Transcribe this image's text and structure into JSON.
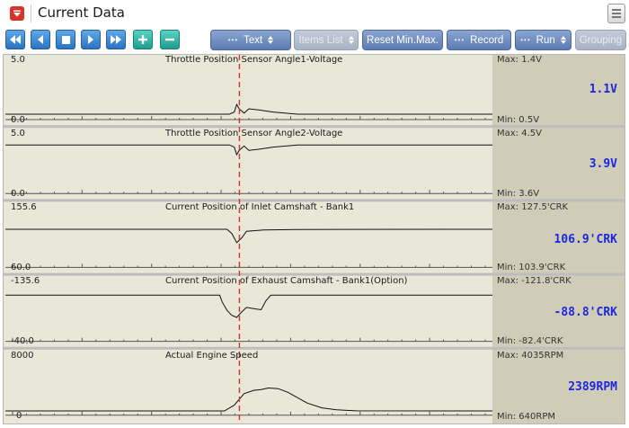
{
  "window": {
    "title": "Current Data"
  },
  "toolbar": {
    "text_button": "Text",
    "items_list_button": "Items List",
    "reset_button": "Reset Min.Max.",
    "record_button": "Record",
    "run_button": "Run",
    "grouping_button": "Grouping",
    "nav_icons": [
      "rewind-icon",
      "step-back-icon",
      "stop-icon",
      "play-icon",
      "fast-forward-icon",
      "plus-icon",
      "minus-icon"
    ]
  },
  "colors": {
    "plot_bg": "#e9e7d8",
    "value_bg": "#cfcdb7",
    "current_value": "#1d27e0",
    "cursor": "#d9342a",
    "toolbar_blue": "#2b73c0",
    "pill": "#5d7bb1"
  },
  "cursor": {
    "position_fraction": 0.475
  },
  "panels": [
    {
      "title": "Throttle Position Sensor Angle1-Voltage",
      "ymax": "5.0",
      "ymin": "0.0",
      "max": "Max:  1.4V",
      "min": "Min:  0.5V",
      "current": "1.1V",
      "range": [
        0,
        5
      ],
      "trace": [
        [
          0,
          0.5
        ],
        [
          0.46,
          0.5
        ],
        [
          0.47,
          0.7
        ],
        [
          0.475,
          1.4
        ],
        [
          0.48,
          1.0
        ],
        [
          0.49,
          0.6
        ],
        [
          0.5,
          1.0
        ],
        [
          0.52,
          0.9
        ],
        [
          0.55,
          0.7
        ],
        [
          0.6,
          0.5
        ],
        [
          1,
          0.5
        ]
      ]
    },
    {
      "title": "Throttle Position Sensor Angle2-Voltage",
      "ymax": "5.0",
      "ymin": "0.0",
      "max": "Max:  4.5V",
      "min": "Min:  3.6V",
      "current": "3.9V",
      "range": [
        0,
        5
      ],
      "trace": [
        [
          0,
          4.5
        ],
        [
          0.46,
          4.5
        ],
        [
          0.47,
          4.3
        ],
        [
          0.475,
          3.6
        ],
        [
          0.48,
          4.0
        ],
        [
          0.49,
          4.4
        ],
        [
          0.5,
          4.0
        ],
        [
          0.52,
          4.1
        ],
        [
          0.55,
          4.3
        ],
        [
          0.6,
          4.5
        ],
        [
          1,
          4.5
        ]
      ]
    },
    {
      "title": "Current Position of Inlet Camshaft - Bank1",
      "ymax": "155.6",
      "ymin": "60.0",
      "max": "Max: 127.5'CRK",
      "min": "Min: 103.9'CRK",
      "current": "106.9'CRK",
      "range": [
        60,
        155.6
      ],
      "trace": [
        [
          0,
          127.5
        ],
        [
          0.455,
          127.5
        ],
        [
          0.465,
          120
        ],
        [
          0.475,
          103.9
        ],
        [
          0.485,
          112
        ],
        [
          0.495,
          124
        ],
        [
          0.53,
          126.5
        ],
        [
          0.6,
          127.2
        ],
        [
          1,
          127.5
        ]
      ]
    },
    {
      "title": "Current Position of Exhaust Camshaft - Bank1(Option)",
      "ymax": "-135.6",
      "ymin": "-40.0",
      "max": "Max: -121.8'CRK",
      "min": "Min: -82.4'CRK",
      "current": "-88.8'CRK",
      "range": [
        -40,
        -135.6
      ],
      "trace": [
        [
          0,
          -121.8
        ],
        [
          0.44,
          -121.8
        ],
        [
          0.445,
          -110
        ],
        [
          0.455,
          -95
        ],
        [
          0.465,
          -86
        ],
        [
          0.475,
          -82.4
        ],
        [
          0.485,
          -92
        ],
        [
          0.495,
          -100
        ],
        [
          0.51,
          -98
        ],
        [
          0.525,
          -96
        ],
        [
          0.535,
          -112
        ],
        [
          0.545,
          -121.8
        ],
        [
          1,
          -121.8
        ]
      ]
    },
    {
      "title": "Actual Engine Speed",
      "ymax": "8000",
      "ymin": "0",
      "max": "Max:  4035RPM",
      "min": "Min:  640RPM",
      "current": "2389RPM",
      "range": [
        0,
        8000
      ],
      "trace": [
        [
          0,
          640
        ],
        [
          0.45,
          640
        ],
        [
          0.47,
          1500
        ],
        [
          0.49,
          3200
        ],
        [
          0.51,
          3700
        ],
        [
          0.525,
          3800
        ],
        [
          0.54,
          4035
        ],
        [
          0.56,
          3950
        ],
        [
          0.58,
          3400
        ],
        [
          0.6,
          2600
        ],
        [
          0.62,
          1800
        ],
        [
          0.65,
          1100
        ],
        [
          0.68,
          800
        ],
        [
          0.72,
          660
        ],
        [
          1,
          640
        ]
      ]
    }
  ]
}
